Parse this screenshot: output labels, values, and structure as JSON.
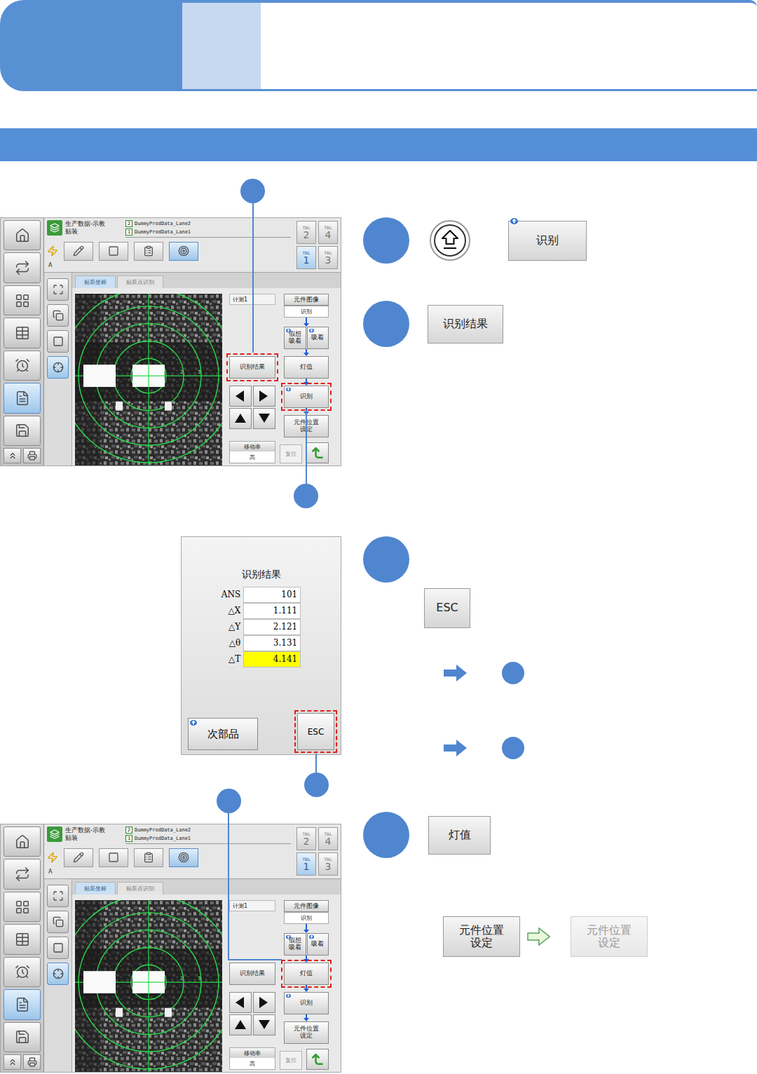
{
  "screens": [
    {
      "title_lines": [
        "生产数据-示教",
        "贴装"
      ],
      "lanes": [
        {
          "number": "2",
          "name": "DummyProdData_Lane2"
        },
        {
          "number": "1",
          "name": "DummyProdData_Lane1"
        }
      ],
      "head": "A",
      "sidebar_items": [
        {
          "selected": false
        },
        {
          "selected": false
        },
        {
          "selected": false
        },
        {
          "selected": false
        },
        {
          "selected": false
        },
        {
          "selected": true
        },
        {
          "selected": false
        }
      ],
      "toolbar_items": [
        {
          "selected": false
        },
        {
          "selected": false
        },
        {
          "selected": false
        },
        {
          "selected": true
        }
      ],
      "subnav_items": [
        {
          "selected": false
        },
        {
          "selected": false
        },
        {
          "selected": false
        },
        {
          "selected": true
        }
      ],
      "tables": [
        {
          "label": "TBL",
          "number": "2",
          "selected": false
        },
        {
          "label": "TBL",
          "number": "4",
          "selected": false
        },
        {
          "label": "TBL",
          "number": "1",
          "selected": true
        },
        {
          "label": "TBL",
          "number": "3",
          "selected": false
        }
      ],
      "tabs": [
        {
          "label": "贴装坐标",
          "selected": true
        },
        {
          "label": "贴装点识别",
          "selected": false
        }
      ],
      "measure": "计测1",
      "axis_ticks": [
        "1",
        "2",
        "3"
      ],
      "part_image": {
        "label": "元件图像",
        "value": "识别"
      },
      "pick_buttons": [
        {
          "label": "假想吸着",
          "shift_mark": true
        },
        {
          "label": "吸着",
          "shift_mark": true
        }
      ],
      "result_button": {
        "label": "识别结果",
        "highlighted": true
      },
      "flow_buttons": [
        {
          "label": "灯值",
          "shift_mark": false,
          "highlighted": false
        },
        {
          "label": "识别",
          "shift_mark": true,
          "highlighted": true
        },
        {
          "label": "元件位置设定",
          "shift_mark": false,
          "highlighted": false
        }
      ],
      "speed": {
        "label": "移动率",
        "value": "高"
      },
      "reset": "复位"
    },
    {
      "title_lines": [
        "生产数据-示教",
        "贴装"
      ],
      "lanes": [
        {
          "number": "2",
          "name": "DummyProdData_Lane2"
        },
        {
          "number": "1",
          "name": "DummyProdData_Lane1"
        }
      ],
      "head": "A",
      "sidebar_items": [
        {
          "selected": false
        },
        {
          "selected": false
        },
        {
          "selected": false
        },
        {
          "selected": false
        },
        {
          "selected": false
        },
        {
          "selected": true
        },
        {
          "selected": false
        }
      ],
      "toolbar_items": [
        {
          "selected": false
        },
        {
          "selected": false
        },
        {
          "selected": false
        },
        {
          "selected": true
        }
      ],
      "subnav_items": [
        {
          "selected": false
        },
        {
          "selected": false
        },
        {
          "selected": false
        },
        {
          "selected": true
        }
      ],
      "tables": [
        {
          "label": "TBL",
          "number": "2",
          "selected": false
        },
        {
          "label": "TBL",
          "number": "4",
          "selected": false
        },
        {
          "label": "TBL",
          "number": "1",
          "selected": true
        },
        {
          "label": "TBL",
          "number": "3",
          "selected": false
        }
      ],
      "tabs": [
        {
          "label": "贴装坐标",
          "selected": true
        },
        {
          "label": "贴装点识别",
          "selected": false
        }
      ],
      "measure": "计测1",
      "axis_ticks": [
        "1",
        "2",
        "3"
      ],
      "part_image": {
        "label": "元件图像",
        "value": "识别"
      },
      "pick_buttons": [
        {
          "label": "假想吸着",
          "shift_mark": true
        },
        {
          "label": "吸着",
          "shift_mark": true
        }
      ],
      "result_button": {
        "label": "识别结果",
        "highlighted": false
      },
      "flow_buttons": [
        {
          "label": "灯值",
          "shift_mark": false,
          "highlighted": true
        },
        {
          "label": "识别",
          "shift_mark": true,
          "highlighted": false
        },
        {
          "label": "元件位置设定",
          "shift_mark": false,
          "highlighted": false
        }
      ],
      "speed": {
        "label": "移动率",
        "value": "高"
      },
      "reset": "复位"
    }
  ],
  "result_dialog": {
    "title": "识别结果",
    "rows": [
      {
        "label": "ANS",
        "value": "101",
        "highlighted": false
      },
      {
        "label": "△X",
        "value": "1.111",
        "highlighted": false
      },
      {
        "label": "△Y",
        "value": "2.121",
        "highlighted": false
      },
      {
        "label": "△θ",
        "value": "3.131",
        "highlighted": false
      },
      {
        "label": "△T",
        "value": "4.141",
        "highlighted": true
      }
    ],
    "next_button": {
      "label": "次部品",
      "shift_mark": true
    },
    "esc_button": {
      "label": "ESC",
      "highlighted": true
    }
  },
  "steps": [
    {
      "kind": "key-button",
      "button": {
        "label": "识别",
        "shift_mark": true
      }
    },
    {
      "kind": "button",
      "button": {
        "label": "识别结果",
        "shift_mark": false
      }
    },
    {
      "kind": "esc",
      "button": {
        "label": "ESC",
        "shift_mark": false
      },
      "branches": [
        {
          "kind": "goto"
        },
        {
          "kind": "goto"
        }
      ]
    },
    {
      "kind": "light",
      "button": {
        "label": "灯值",
        "shift_mark": false
      },
      "transition": {
        "from": {
          "label": "元件位置设定",
          "disabled": false
        },
        "to": {
          "label": "元件位置设定",
          "disabled": true
        }
      }
    }
  ]
}
